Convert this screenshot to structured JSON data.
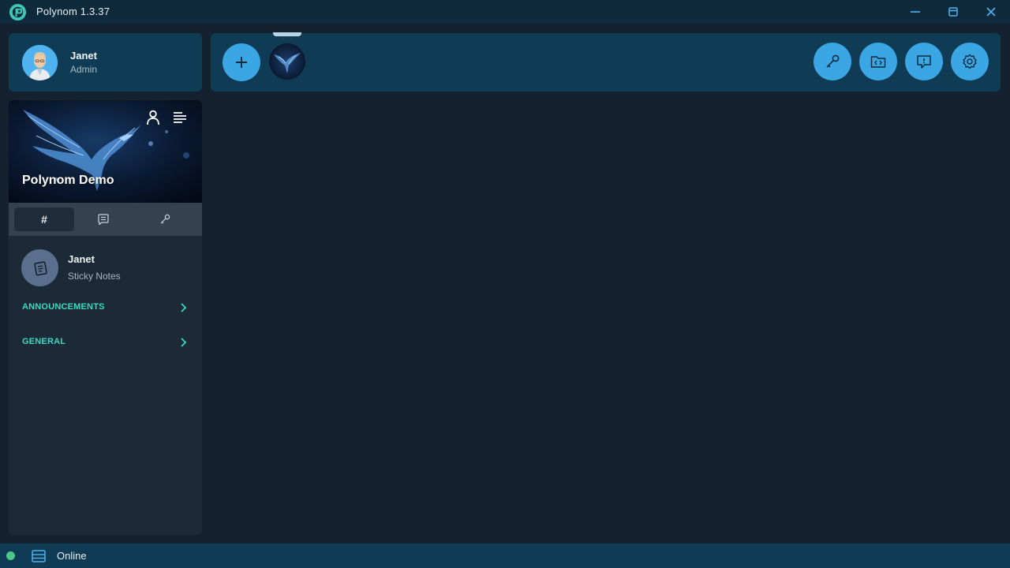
{
  "window": {
    "title": "Polynom 1.3.37"
  },
  "profile": {
    "name": "Janet",
    "role": "Admin"
  },
  "server": {
    "name": "Polynom Demo",
    "tabs": [
      {
        "icon": "hash-icon",
        "label": "#",
        "active": true
      },
      {
        "icon": "chat-icon",
        "active": false
      },
      {
        "icon": "key-icon",
        "active": false
      }
    ]
  },
  "sidebar": {
    "notes": {
      "title": "Janet",
      "subtitle": "Sticky Notes"
    },
    "categories": [
      {
        "label": "ANNOUNCEMENTS"
      },
      {
        "label": "GENERAL"
      }
    ]
  },
  "toolbar": {
    "buttons": [
      "add-server-icon",
      "key-icon",
      "code-folder-icon",
      "info-icon",
      "settings-icon"
    ]
  },
  "status": {
    "text": "Online",
    "color": "#4fc58a"
  },
  "colors": {
    "accent": "#3aa6e4",
    "category": "#3cd9c2",
    "panel": "#0f3b54",
    "background": "#13222e"
  }
}
